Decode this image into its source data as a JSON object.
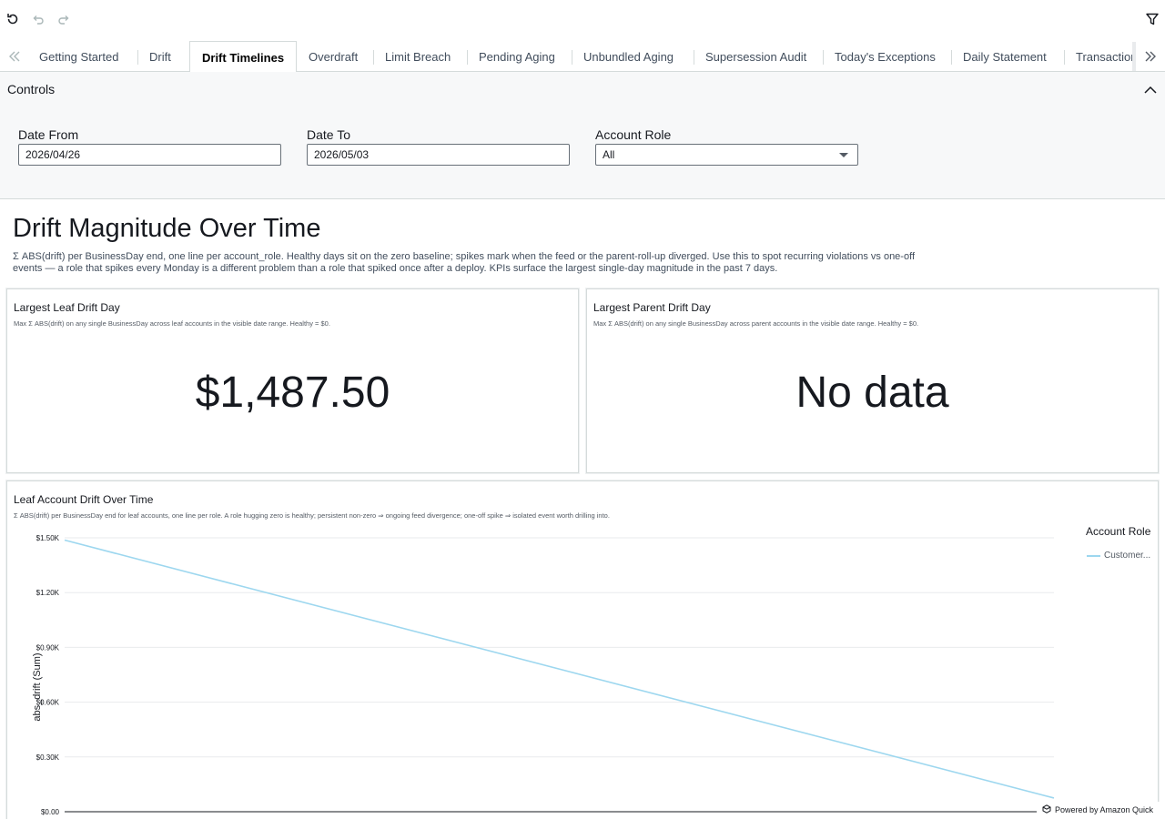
{
  "toolbar": {
    "reset_icon": "reset-icon",
    "undo_icon": "undo-icon",
    "redo_icon": "redo-icon",
    "filter_icon": "filter-icon"
  },
  "tabs": [
    {
      "label": "Getting Started",
      "active": false
    },
    {
      "label": "Drift",
      "active": false
    },
    {
      "label": "Drift Timelines",
      "active": true
    },
    {
      "label": "Overdraft",
      "active": false
    },
    {
      "label": "Limit Breach",
      "active": false
    },
    {
      "label": "Pending Aging",
      "active": false
    },
    {
      "label": "Unbundled Aging",
      "active": false
    },
    {
      "label": "Supersession Audit",
      "active": false
    },
    {
      "label": "Today's Exceptions",
      "active": false
    },
    {
      "label": "Daily Statement",
      "active": false
    },
    {
      "label": "Transactions",
      "active": false
    }
  ],
  "controls": {
    "title": "Controls",
    "date_from": {
      "label": "Date From",
      "value": "2026/04/26"
    },
    "date_to": {
      "label": "Date To",
      "value": "2026/05/03"
    },
    "account_role": {
      "label": "Account Role",
      "value": "All"
    }
  },
  "section": {
    "title": "Drift Magnitude Over Time",
    "description": "Σ ABS(drift) per BusinessDay end, one line per account_role. Healthy days sit on the zero baseline; spikes mark when the feed or the parent-roll-up diverged. Use this to spot recurring violations vs one-off events — a role that spikes every Monday is a different problem than a role that spiked once after a deploy. KPIs surface the largest single-day magnitude in the past 7 days."
  },
  "kpis": {
    "leaf": {
      "title": "Largest Leaf Drift Day",
      "subtitle": "Max Σ ABS(drift) on any single BusinessDay across leaf accounts in the visible date range. Healthy = $0.",
      "value": "$1,487.50"
    },
    "parent": {
      "title": "Largest Parent Drift Day",
      "subtitle": "Max Σ ABS(drift) on any single BusinessDay across parent accounts in the visible date range. Healthy = $0.",
      "value": "No data"
    }
  },
  "chart_card": {
    "title": "Leaf Account Drift Over Time",
    "subtitle": "Σ ABS(drift) per BusinessDay end for leaf accounts, one line per role. A role hugging zero is healthy; persistent non-zero ⇒ ongoing feed divergence; one-off spike ⇒ isolated event worth drilling into.",
    "legend_title": "Account Role"
  },
  "chart_data": {
    "type": "line",
    "title": "",
    "xlabel": "",
    "ylabel": "abs_drift (Sum)",
    "y_ticks": [
      "$0.00",
      "$0.30K",
      "$0.60K",
      "$0.90K",
      "$1.20K",
      "$1.50K"
    ],
    "ylim": [
      0,
      1500
    ],
    "grid": true,
    "legend_position": "right",
    "series": [
      {
        "name": "Customer...",
        "color": "#9dd7ef",
        "x": [
          0,
          1
        ],
        "values": [
          1487.5,
          75
        ]
      }
    ]
  },
  "footer": {
    "powered_by": "Powered by Amazon Quick"
  }
}
